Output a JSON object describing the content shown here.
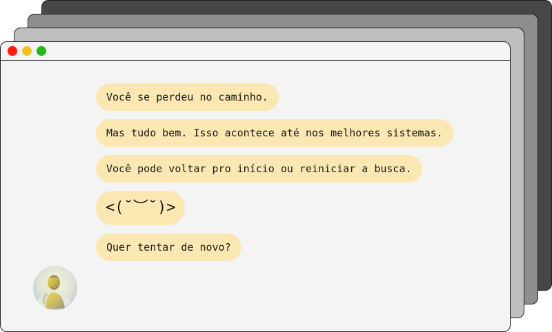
{
  "window": {
    "controls": [
      {
        "name": "close",
        "color": "#ff1a0c"
      },
      {
        "name": "minimize",
        "color": "#f5c21a"
      },
      {
        "name": "maximize",
        "color": "#28b41b"
      }
    ],
    "stack_colors": [
      "#bfbfbf",
      "#8e8e8e",
      "#474747"
    ],
    "background": "#f4f4f4"
  },
  "chat": {
    "bubble_color": "#fbe7b1",
    "messages": [
      "Você se perdeu no caminho.",
      "Mas tudo bem. Isso acontece até nos melhores sistemas.",
      "Você pode voltar pro início ou reiniciar a busca.",
      "<(˘︶˘)>",
      "Quer tentar de novo?"
    ]
  },
  "avatar": {
    "icon": "avatar-image"
  }
}
